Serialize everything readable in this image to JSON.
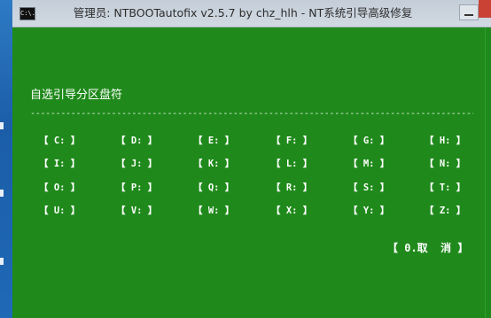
{
  "window": {
    "title": "管理员:  NTBOOTautofix v2.5.7 by chz_hlh - NT系统引导高级修复",
    "icon_text": "C:\\."
  },
  "colors": {
    "console_background": "#1f8a1b",
    "console_text": "#ffffff",
    "titlebar": "#cfd7df",
    "close_button": "#c94234"
  },
  "screen": {
    "heading": "自选引导分区盘符",
    "divider": "------------------------------------------------------------------------------------------------",
    "drives": [
      "【 C: 】",
      "【 D: 】",
      "【 E: 】",
      "【 F: 】",
      "【 G: 】",
      "【 H: 】",
      "【 I: 】",
      "【 J: 】",
      "【 K: 】",
      "【 L: 】",
      "【 M: 】",
      "【 N: 】",
      "【 O: 】",
      "【 P: 】",
      "【 Q: 】",
      "【 R: 】",
      "【 S: 】",
      "【 T: 】",
      "【 U: 】",
      "【 V: 】",
      "【 W: 】",
      "【 X: 】",
      "【 Y: 】",
      "【 Z: 】"
    ],
    "cancel": "【 0.取  消 】"
  }
}
